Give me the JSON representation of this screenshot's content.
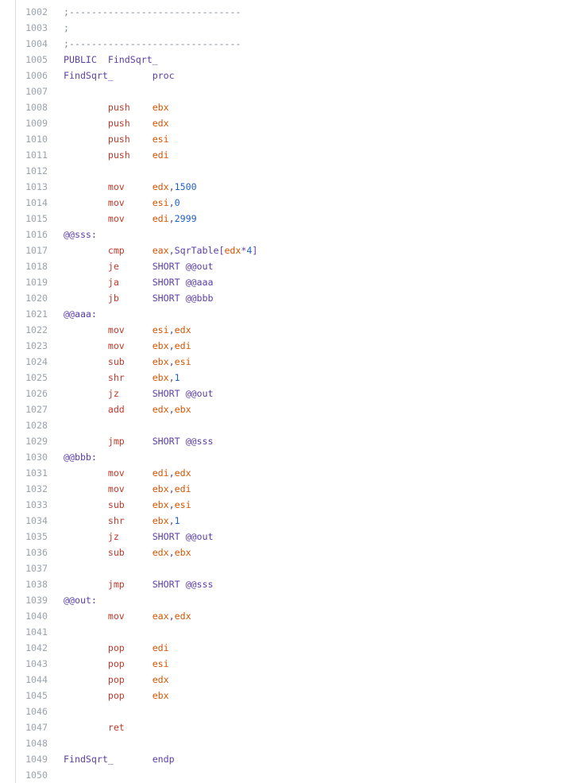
{
  "editor": {
    "lines": [
      {
        "n": "1002",
        "tokens": [
          {
            "t": ";-------------------------------",
            "k": "comment"
          }
        ]
      },
      {
        "n": "1003",
        "tokens": [
          {
            "t": ";",
            "k": "comment"
          }
        ]
      },
      {
        "n": "1004",
        "tokens": [
          {
            "t": ";-------------------------------",
            "k": "comment"
          }
        ]
      },
      {
        "n": "1005",
        "tokens": [
          {
            "t": "PUBLIC  FindSqrt_",
            "k": "label"
          }
        ]
      },
      {
        "n": "1006",
        "tokens": [
          {
            "t": "FindSqrt_       ",
            "k": "label"
          },
          {
            "t": "proc",
            "k": "label"
          }
        ]
      },
      {
        "n": "1007",
        "tokens": []
      },
      {
        "n": "1008",
        "tokens": [
          {
            "t": "        push    ",
            "k": "kw"
          },
          {
            "t": "ebx",
            "k": "reg"
          }
        ]
      },
      {
        "n": "1009",
        "tokens": [
          {
            "t": "        push    ",
            "k": "kw"
          },
          {
            "t": "edx",
            "k": "reg"
          }
        ]
      },
      {
        "n": "1010",
        "tokens": [
          {
            "t": "        push    ",
            "k": "kw"
          },
          {
            "t": "esi",
            "k": "reg"
          }
        ]
      },
      {
        "n": "1011",
        "tokens": [
          {
            "t": "        push    ",
            "k": "kw"
          },
          {
            "t": "edi",
            "k": "reg"
          }
        ]
      },
      {
        "n": "1012",
        "tokens": []
      },
      {
        "n": "1013",
        "tokens": [
          {
            "t": "        mov     ",
            "k": "kw"
          },
          {
            "t": "edx",
            "k": "reg"
          },
          {
            "t": ",",
            "k": "punct"
          },
          {
            "t": "1500",
            "k": "num"
          }
        ]
      },
      {
        "n": "1014",
        "tokens": [
          {
            "t": "        mov     ",
            "k": "kw"
          },
          {
            "t": "esi",
            "k": "reg"
          },
          {
            "t": ",",
            "k": "punct"
          },
          {
            "t": "0",
            "k": "num"
          }
        ]
      },
      {
        "n": "1015",
        "tokens": [
          {
            "t": "        mov     ",
            "k": "kw"
          },
          {
            "t": "edi",
            "k": "reg"
          },
          {
            "t": ",",
            "k": "punct"
          },
          {
            "t": "2999",
            "k": "num"
          }
        ]
      },
      {
        "n": "1016",
        "tokens": [
          {
            "t": "@@sss:",
            "k": "label"
          }
        ]
      },
      {
        "n": "1017",
        "tokens": [
          {
            "t": "        cmp     ",
            "k": "kw"
          },
          {
            "t": "eax",
            "k": "reg"
          },
          {
            "t": ",SqrTable[",
            "k": "punct"
          },
          {
            "t": "edx",
            "k": "reg"
          },
          {
            "t": "*",
            "k": "punct"
          },
          {
            "t": "4",
            "k": "num"
          },
          {
            "t": "]",
            "k": "punct"
          }
        ]
      },
      {
        "n": "1018",
        "tokens": [
          {
            "t": "        je      ",
            "k": "kw"
          },
          {
            "t": "SHORT @@out",
            "k": "label"
          }
        ]
      },
      {
        "n": "1019",
        "tokens": [
          {
            "t": "        ja      ",
            "k": "kw"
          },
          {
            "t": "SHORT @@aaa",
            "k": "label"
          }
        ]
      },
      {
        "n": "1020",
        "tokens": [
          {
            "t": "        jb      ",
            "k": "kw"
          },
          {
            "t": "SHORT @@bbb",
            "k": "label"
          }
        ]
      },
      {
        "n": "1021",
        "tokens": [
          {
            "t": "@@aaa:",
            "k": "label"
          }
        ]
      },
      {
        "n": "1022",
        "tokens": [
          {
            "t": "        mov     ",
            "k": "kw"
          },
          {
            "t": "esi",
            "k": "reg"
          },
          {
            "t": ",",
            "k": "punct"
          },
          {
            "t": "edx",
            "k": "reg"
          }
        ]
      },
      {
        "n": "1023",
        "tokens": [
          {
            "t": "        mov     ",
            "k": "kw"
          },
          {
            "t": "ebx",
            "k": "reg"
          },
          {
            "t": ",",
            "k": "punct"
          },
          {
            "t": "edi",
            "k": "reg"
          }
        ]
      },
      {
        "n": "1024",
        "tokens": [
          {
            "t": "        sub     ",
            "k": "kw"
          },
          {
            "t": "ebx",
            "k": "reg"
          },
          {
            "t": ",",
            "k": "punct"
          },
          {
            "t": "esi",
            "k": "reg"
          }
        ]
      },
      {
        "n": "1025",
        "tokens": [
          {
            "t": "        shr     ",
            "k": "kw"
          },
          {
            "t": "ebx",
            "k": "reg"
          },
          {
            "t": ",",
            "k": "punct"
          },
          {
            "t": "1",
            "k": "num"
          }
        ]
      },
      {
        "n": "1026",
        "tokens": [
          {
            "t": "        jz      ",
            "k": "kw"
          },
          {
            "t": "SHORT @@out",
            "k": "label"
          }
        ]
      },
      {
        "n": "1027",
        "tokens": [
          {
            "t": "        add     ",
            "k": "kw"
          },
          {
            "t": "edx",
            "k": "reg"
          },
          {
            "t": ",",
            "k": "punct"
          },
          {
            "t": "ebx",
            "k": "reg"
          }
        ]
      },
      {
        "n": "1028",
        "tokens": []
      },
      {
        "n": "1029",
        "tokens": [
          {
            "t": "        jmp     ",
            "k": "kw"
          },
          {
            "t": "SHORT @@sss",
            "k": "label"
          }
        ]
      },
      {
        "n": "1030",
        "tokens": [
          {
            "t": "@@bbb:",
            "k": "label"
          }
        ]
      },
      {
        "n": "1031",
        "tokens": [
          {
            "t": "        mov     ",
            "k": "kw"
          },
          {
            "t": "edi",
            "k": "reg"
          },
          {
            "t": ",",
            "k": "punct"
          },
          {
            "t": "edx",
            "k": "reg"
          }
        ]
      },
      {
        "n": "1032",
        "tokens": [
          {
            "t": "        mov     ",
            "k": "kw"
          },
          {
            "t": "ebx",
            "k": "reg"
          },
          {
            "t": ",",
            "k": "punct"
          },
          {
            "t": "edi",
            "k": "reg"
          }
        ]
      },
      {
        "n": "1033",
        "tokens": [
          {
            "t": "        sub     ",
            "k": "kw"
          },
          {
            "t": "ebx",
            "k": "reg"
          },
          {
            "t": ",",
            "k": "punct"
          },
          {
            "t": "esi",
            "k": "reg"
          }
        ]
      },
      {
        "n": "1034",
        "tokens": [
          {
            "t": "        shr     ",
            "k": "kw"
          },
          {
            "t": "ebx",
            "k": "reg"
          },
          {
            "t": ",",
            "k": "punct"
          },
          {
            "t": "1",
            "k": "num"
          }
        ]
      },
      {
        "n": "1035",
        "tokens": [
          {
            "t": "        jz      ",
            "k": "kw"
          },
          {
            "t": "SHORT @@out",
            "k": "label"
          }
        ]
      },
      {
        "n": "1036",
        "tokens": [
          {
            "t": "        sub     ",
            "k": "kw"
          },
          {
            "t": "edx",
            "k": "reg"
          },
          {
            "t": ",",
            "k": "punct"
          },
          {
            "t": "ebx",
            "k": "reg"
          }
        ]
      },
      {
        "n": "1037",
        "tokens": []
      },
      {
        "n": "1038",
        "tokens": [
          {
            "t": "        jmp     ",
            "k": "kw"
          },
          {
            "t": "SHORT @@sss",
            "k": "label"
          }
        ]
      },
      {
        "n": "1039",
        "tokens": [
          {
            "t": "@@out:",
            "k": "label"
          }
        ]
      },
      {
        "n": "1040",
        "tokens": [
          {
            "t": "        mov     ",
            "k": "kw"
          },
          {
            "t": "eax",
            "k": "reg"
          },
          {
            "t": ",",
            "k": "punct"
          },
          {
            "t": "edx",
            "k": "reg"
          }
        ]
      },
      {
        "n": "1041",
        "tokens": []
      },
      {
        "n": "1042",
        "tokens": [
          {
            "t": "        pop     ",
            "k": "kw"
          },
          {
            "t": "edi",
            "k": "reg"
          }
        ]
      },
      {
        "n": "1043",
        "tokens": [
          {
            "t": "        pop     ",
            "k": "kw"
          },
          {
            "t": "esi",
            "k": "reg"
          }
        ]
      },
      {
        "n": "1044",
        "tokens": [
          {
            "t": "        pop     ",
            "k": "kw"
          },
          {
            "t": "edx",
            "k": "reg"
          }
        ]
      },
      {
        "n": "1045",
        "tokens": [
          {
            "t": "        pop     ",
            "k": "kw"
          },
          {
            "t": "ebx",
            "k": "reg"
          }
        ]
      },
      {
        "n": "1046",
        "tokens": []
      },
      {
        "n": "1047",
        "tokens": [
          {
            "t": "        ret",
            "k": "kw"
          }
        ]
      },
      {
        "n": "1048",
        "tokens": []
      },
      {
        "n": "1049",
        "tokens": [
          {
            "t": "FindSqrt_       ",
            "k": "label"
          },
          {
            "t": "endp",
            "k": "label"
          }
        ]
      },
      {
        "n": "1050",
        "tokens": []
      }
    ]
  }
}
